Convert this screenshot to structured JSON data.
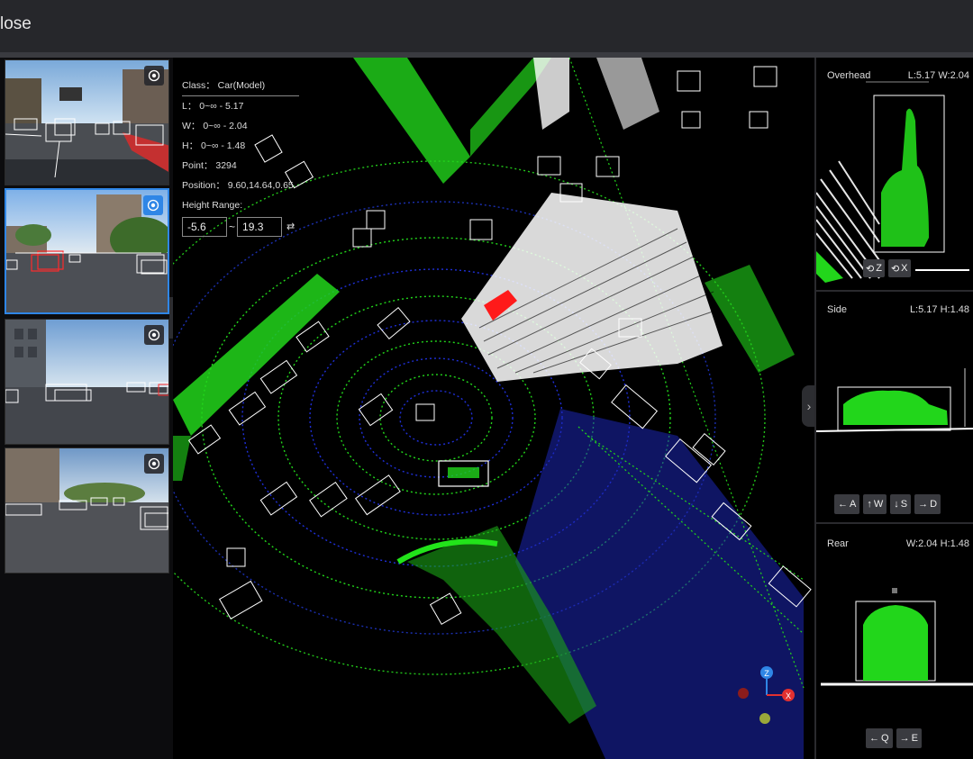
{
  "window": {
    "title": "lose"
  },
  "info_panel": {
    "class_line": "Class： Car(Model)",
    "length_line": "L： 0~∞ - 5.17",
    "width_line": "W： 0~∞ - 2.04",
    "height_line": "H： 0~∞ - 1.48",
    "point_line": "Point： 3294",
    "position_line": "Position： 9.60,14.64,0.65",
    "height_range_label": "Height Range:",
    "height_min": "-5.6",
    "height_sep": "~",
    "height_max": "19.3"
  },
  "panels": {
    "overhead": {
      "title": "Overhead",
      "dims": "L:5.17 W:2.04",
      "btn_z": "Z",
      "btn_x": "X"
    },
    "side": {
      "title": "Side",
      "dims": "L:5.17 H:1.48",
      "btn_a": "A",
      "btn_w": "W",
      "btn_s": "S",
      "btn_d": "D"
    },
    "rear": {
      "title": "Rear",
      "dims": "W:2.04 H:1.48",
      "btn_q": "Q",
      "btn_e": "E"
    }
  },
  "axis_gizmo": {
    "z": "Z",
    "x": "X"
  },
  "icons": {
    "camera_toggle": "eye-icon",
    "collapse_left": "chevron-left-icon",
    "collapse_right": "chevron-right-icon",
    "swap": "swap-icon"
  },
  "colors": {
    "accent": "#2f86e6",
    "points_green": "#22e31a",
    "points_blue": "#1b2fd6",
    "points_white": "#ffffff",
    "selected_box": "#ff1a1a"
  }
}
